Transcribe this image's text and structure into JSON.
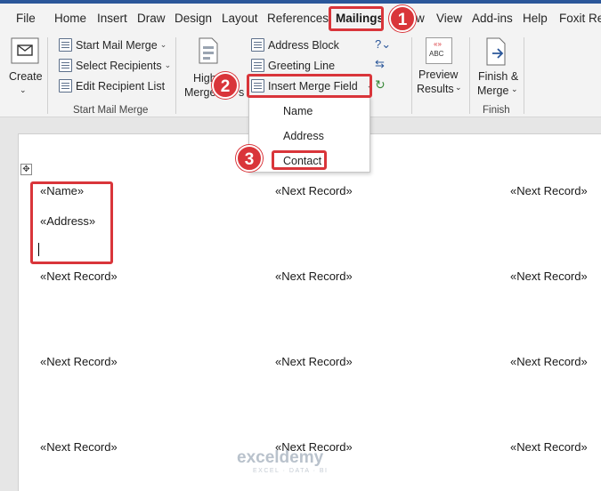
{
  "tabs": [
    "File",
    "Home",
    "Insert",
    "Draw",
    "Design",
    "Layout",
    "References",
    "Mailings",
    "w",
    "View",
    "Add-ins",
    "Help",
    "Foxit Re"
  ],
  "ribbon": {
    "create": "Create",
    "start_mail_merge": "Start Mail Merge",
    "select_recipients": "Select Recipients",
    "edit_recipient_list": "Edit Recipient List",
    "group_start": "Start Mail Merge",
    "highlight_top": "High",
    "highlight_bottom": "Merge",
    "highlight_s": "s",
    "address_block": "Address Block",
    "greeting_line": "Greeting Line",
    "insert_merge_field": "Insert Merge Field",
    "preview_abc": "ABC",
    "preview_top": "Preview",
    "preview_bottom": "Results",
    "finish_top": "Finish &",
    "finish_bottom": "Merge",
    "group_finish": "Finish"
  },
  "dropdown": {
    "items": [
      "Name",
      "Address",
      "Contact"
    ]
  },
  "document": {
    "name_field": "«Name»",
    "address_field": "«Address»",
    "next_record": "«Next Record»"
  },
  "steps": [
    "1",
    "2",
    "3"
  ],
  "watermark": {
    "brand": "exceldemy",
    "tagline": "EXCEL · DATA · BI"
  },
  "colors": {
    "accent": "#2b579a",
    "highlight": "#d9353a"
  }
}
